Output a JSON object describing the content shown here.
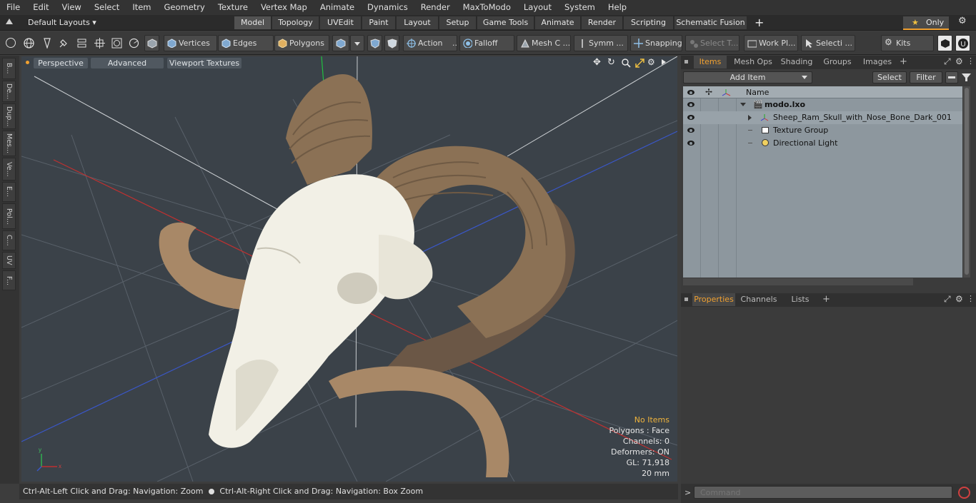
{
  "menu": [
    "File",
    "Edit",
    "View",
    "Select",
    "Item",
    "Geometry",
    "Texture",
    "Vertex Map",
    "Animate",
    "Dynamics",
    "Render",
    "MaxToModo",
    "Layout",
    "System",
    "Help"
  ],
  "layout": {
    "default_layouts": "Default Layouts ▾",
    "tabs": [
      "Model",
      "Topology",
      "UVEdit",
      "Paint",
      "Layout",
      "Setup",
      "Game Tools",
      "Animate",
      "Render",
      "Scripting",
      "Schematic Fusion"
    ],
    "active_tab": "Model",
    "add_tab": "+",
    "only_label": "Only"
  },
  "toolbar": {
    "vertices": "Vertices",
    "edges": "Edges",
    "polygons": "Polygons",
    "action": "Action",
    "falloff": "Falloff",
    "mesh_c": "Mesh C ...",
    "symm": "Symm ...",
    "snapping": "Snapping",
    "select_t": "Select T...",
    "work_pl": "Work Pl...",
    "selecti": "Selecti ...",
    "kits": "Kits"
  },
  "left_tabs": [
    "B...",
    "De...",
    "Dup...",
    "Mes...",
    "Ve...",
    "E...",
    "Pol...",
    "C...",
    "UV",
    "F..."
  ],
  "viewport": {
    "perspective": "Perspective",
    "advanced": "Advanced",
    "viewport_textures": "Viewport Textures",
    "stats": {
      "no_items": "No Items",
      "polygons": "Polygons : Face",
      "channels": "Channels: 0",
      "deformers": "Deformers: ON",
      "gl": "GL: 71,918",
      "scale": "20 mm"
    },
    "colors": {
      "background": "#3b4249",
      "bone": "#f2f0e6",
      "horn": "#8b7155"
    }
  },
  "status": {
    "hint1": "Ctrl-Alt-Left Click and Drag: Navigation: Zoom",
    "hint2": "Ctrl-Alt-Right Click and Drag: Navigation: Box Zoom"
  },
  "items_panel": {
    "tabs": [
      "Items",
      "Mesh Ops",
      "Shading",
      "Groups",
      "Images"
    ],
    "active_tab": "Items",
    "add_item": "Add Item",
    "select": "Select",
    "filter": "Filter",
    "column_name": "Name",
    "tree": [
      {
        "label": "modo.lxo",
        "bold": true
      },
      {
        "label": "Sheep_Ram_Skull_with_Nose_Bone_Dark_001"
      },
      {
        "label": "Texture Group"
      },
      {
        "label": "Directional Light"
      }
    ]
  },
  "properties_panel": {
    "tabs": [
      "Properties",
      "Channels",
      "Lists"
    ],
    "active_tab": "Properties"
  },
  "command": {
    "placeholder": "Command"
  },
  "accent_color": "#f0a030"
}
